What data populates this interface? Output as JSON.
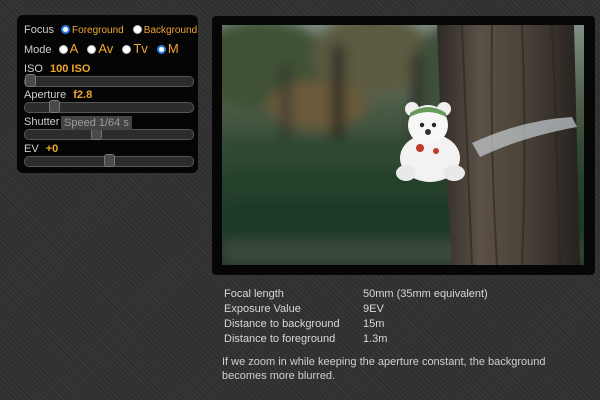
{
  "controls": {
    "focus": {
      "label": "Focus",
      "options": [
        "Foreground",
        "Background"
      ],
      "selected": "Foreground"
    },
    "mode": {
      "label": "Mode",
      "options": [
        "A",
        "Av",
        "Tv",
        "M"
      ],
      "selected": "M"
    },
    "iso": {
      "label": "ISO",
      "value": "100 ISO",
      "slider_level": 0.0
    },
    "aperture": {
      "label": "Aperture",
      "value": "f2.8",
      "slider_level": 0.15
    },
    "shutter": {
      "label": "Shutter",
      "tooltip": "Speed 1/64 s",
      "slider_level": 0.42
    },
    "ev": {
      "label": "EV",
      "value": "+0",
      "slider_level": 0.5
    }
  },
  "photo": {
    "subject": "plush bear tied to tree trunk in a park",
    "colors": {
      "sky": "#8fa39a",
      "hedge": "#25412c",
      "trunk": "#4a4239"
    }
  },
  "info": {
    "rows": [
      {
        "label": "Focal length",
        "value": "50mm (35mm equivalent)"
      },
      {
        "label": "Exposure Value",
        "value": "9EV"
      },
      {
        "label": "Distance to background",
        "value": "15m"
      },
      {
        "label": "Distance to foreground",
        "value": "1.3m"
      }
    ],
    "description": "If we zoom in while keeping the aperture constant, the background becomes more blurred."
  },
  "colors": {
    "accent": "#f0a630",
    "radio_selected": "#2a7be4",
    "panel": "#050505"
  }
}
